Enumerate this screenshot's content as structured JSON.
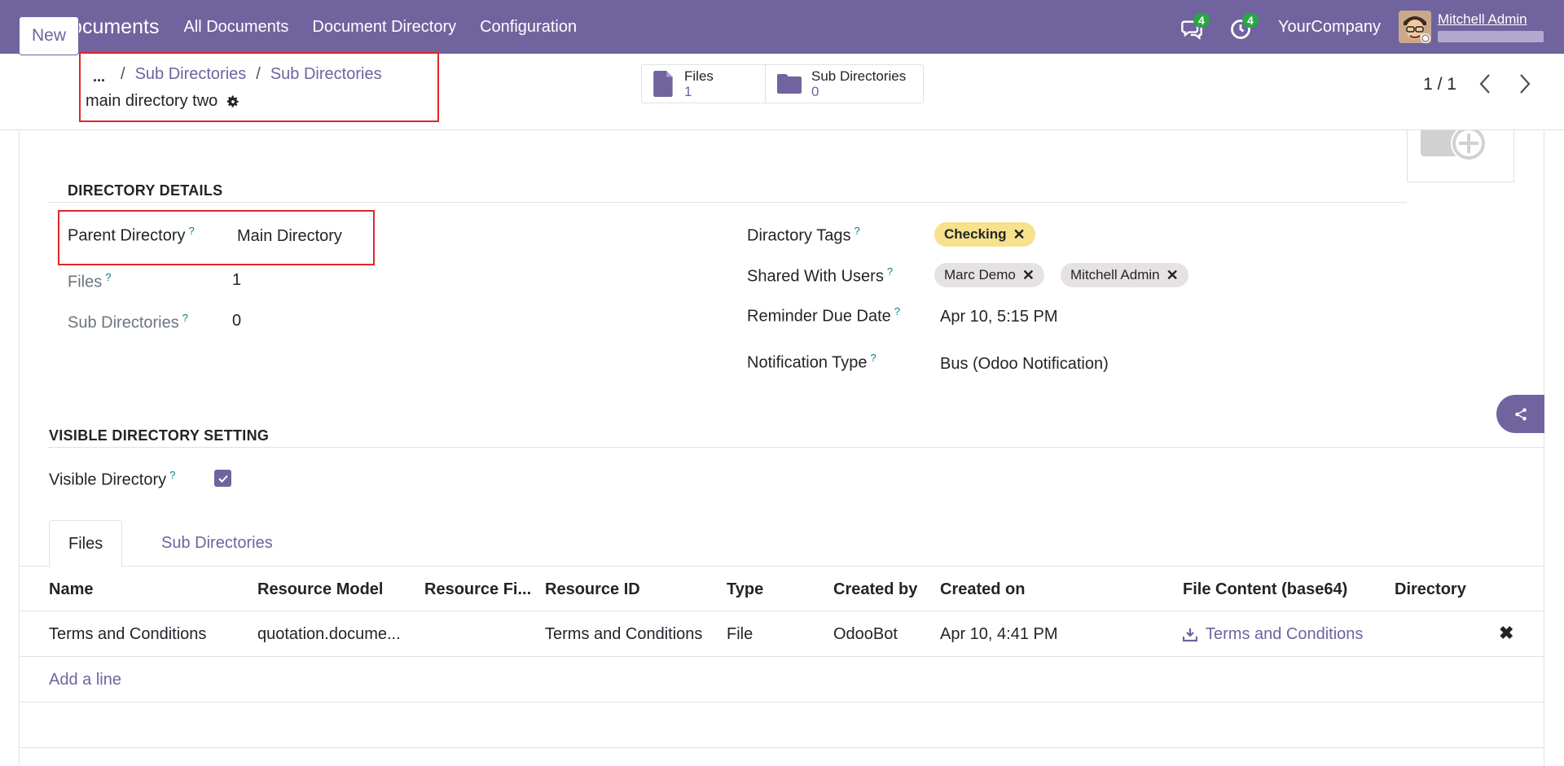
{
  "navbar": {
    "app_name": "Documents",
    "menus": [
      "All Documents",
      "Document Directory",
      "Configuration"
    ],
    "messages_count": "4",
    "activities_count": "4",
    "company": "YourCompany",
    "user": "Mitchell Admin"
  },
  "control": {
    "new_label": "New",
    "breadcrumb_ellipsis": "...",
    "breadcrumbs": [
      "Sub Directories",
      "Sub Directories"
    ],
    "record_name": "main directory two",
    "stats": [
      {
        "label": "Files",
        "value": "1"
      },
      {
        "label": "Sub Directories",
        "value": "0"
      }
    ],
    "pager": "1 / 1"
  },
  "details": {
    "section_title": "DIRECTORY DETAILS",
    "parent_label": "Parent Directory",
    "parent_value": "Main Directory",
    "files_label": "Files",
    "files_value": "1",
    "subdirs_label": "Sub Directories",
    "subdirs_value": "0",
    "tags_label": "Diractory Tags",
    "tags": [
      "Checking"
    ],
    "shared_label": "Shared With Users",
    "shared_users": [
      "Marc Demo",
      "Mitchell Admin"
    ],
    "reminder_label": "Reminder Due Date",
    "reminder_value": "Apr 10, 5:15 PM",
    "notification_label": "Notification Type",
    "notification_value": "Bus (Odoo Notification)"
  },
  "visible_setting": {
    "section_title": "VISIBLE DIRECTORY SETTING",
    "visible_label": "Visible Directory",
    "visible_checked": true
  },
  "tabs": [
    "Files",
    "Sub Directories"
  ],
  "table": {
    "headers": [
      "Name",
      "Resource Model",
      "Resource Fi...",
      "Resource ID",
      "Type",
      "Created by",
      "Created on",
      "File Content (base64)",
      "Directory"
    ],
    "rows": [
      {
        "name": "Terms and Conditions",
        "resource_model": "quotation.docume...",
        "resource_field": "",
        "resource_id": "Terms and Conditions",
        "type": "File",
        "created_by": "OdooBot",
        "created_on": "Apr 10, 4:41 PM",
        "file_content": "Terms and Conditions",
        "directory": ""
      }
    ],
    "add_line": "Add a line"
  },
  "colors": {
    "brand": "#71639e",
    "highlight": "#e0262b",
    "tag_yellow": "#f8e18c",
    "badge_green": "#28a745"
  }
}
